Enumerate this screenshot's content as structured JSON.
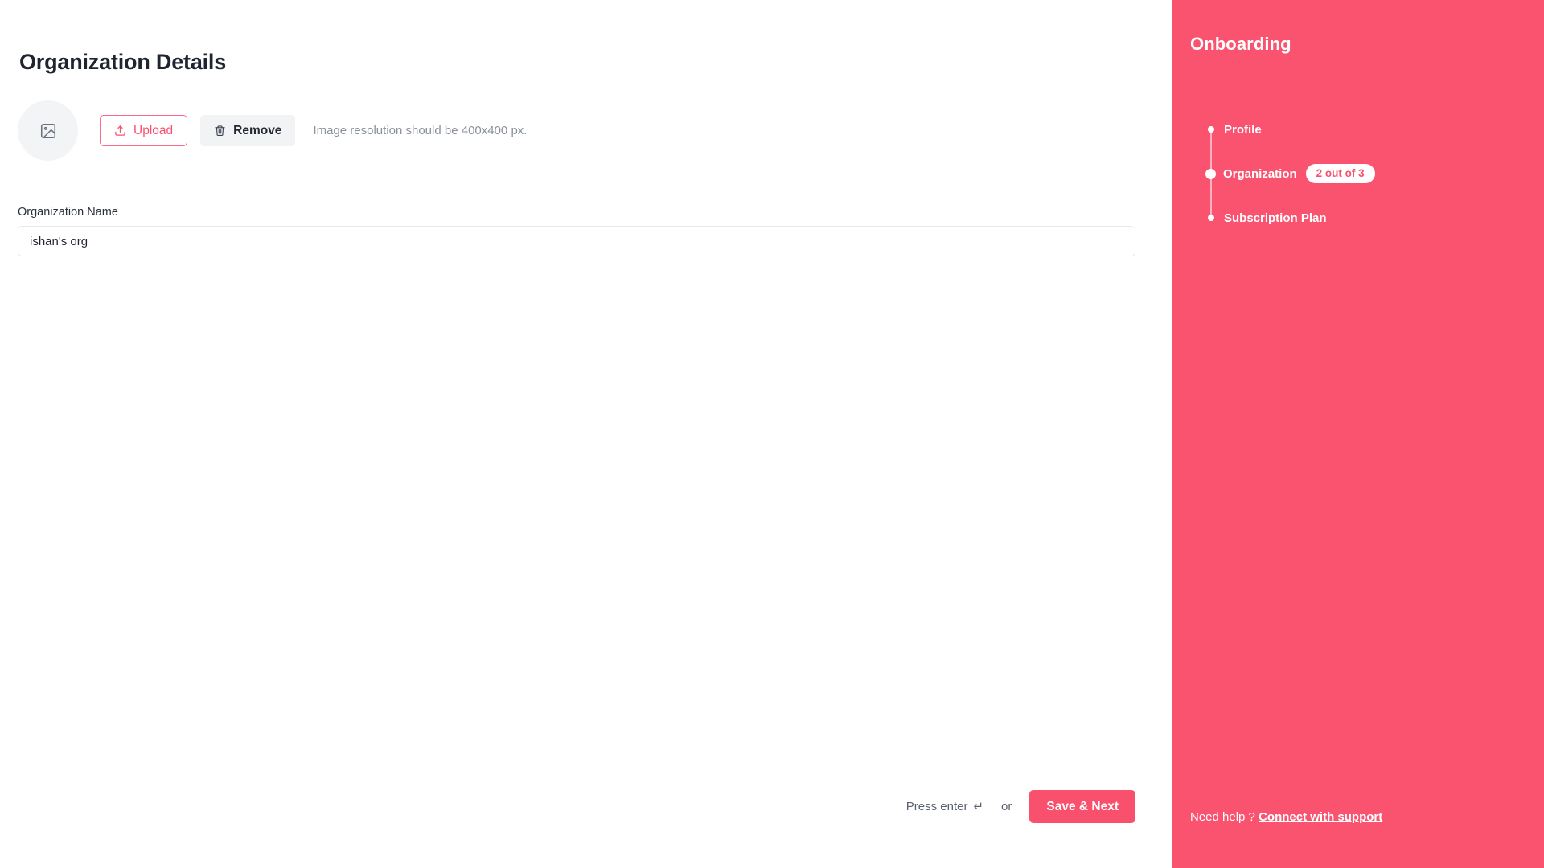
{
  "main": {
    "page_title": "Organization Details",
    "avatar": {
      "icon": "image-placeholder-icon"
    },
    "upload": {
      "upload_label": "Upload",
      "upload_icon": "upload-icon",
      "remove_label": "Remove",
      "remove_icon": "trash-icon",
      "hint": "Image resolution should be 400x400 px."
    },
    "form": {
      "org_name_label": "Organization Name",
      "org_name_value": "ishan's org",
      "org_name_placeholder": "Organization Name"
    },
    "footer": {
      "press_enter_text": "Press enter",
      "enter_glyph": "↵",
      "or_text": "or",
      "save_label": "Save & Next"
    }
  },
  "sidebar": {
    "title": "Onboarding",
    "steps": [
      {
        "label": "Profile",
        "badge": "",
        "active": false
      },
      {
        "label": "Organization",
        "badge": "2 out of 3",
        "active": true
      },
      {
        "label": "Subscription Plan",
        "badge": "",
        "active": false
      }
    ],
    "help_text": "Need help ?",
    "help_link": "Connect with support"
  },
  "colors": {
    "accent": "#f9506e",
    "sidebar_bg": "#fa5370",
    "avatar_bg": "#f3f4f6",
    "remove_bg": "#f2f3f5",
    "text_dark": "#1f2430",
    "text_muted": "#8a9099"
  }
}
